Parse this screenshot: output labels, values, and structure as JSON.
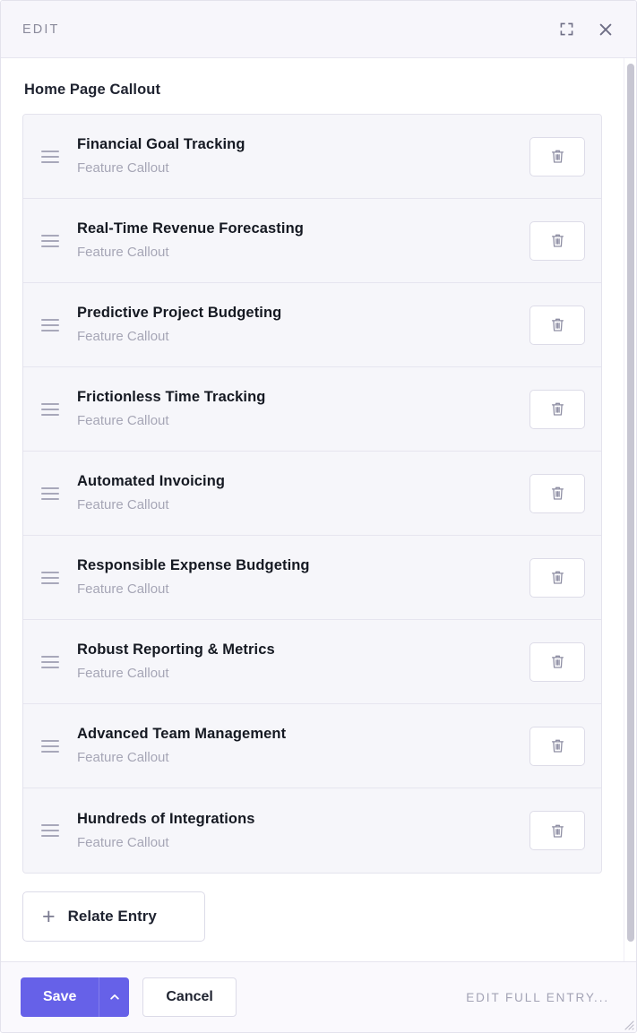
{
  "header": {
    "title": "EDIT",
    "expand_icon": "expand-fullscreen-icon",
    "close_icon": "close-icon"
  },
  "field": {
    "label": "Home Page Callout",
    "items": [
      {
        "title": "Financial Goal Tracking",
        "subtitle": "Feature Callout",
        "drag_icon": "drag-handle-icon",
        "delete_icon": "trash-icon"
      },
      {
        "title": "Real-Time Revenue Forecasting",
        "subtitle": "Feature Callout",
        "drag_icon": "drag-handle-icon",
        "delete_icon": "trash-icon"
      },
      {
        "title": "Predictive Project Budgeting",
        "subtitle": "Feature Callout",
        "drag_icon": "drag-handle-icon",
        "delete_icon": "trash-icon"
      },
      {
        "title": "Frictionless Time Tracking",
        "subtitle": "Feature Callout",
        "drag_icon": "drag-handle-icon",
        "delete_icon": "trash-icon"
      },
      {
        "title": "Automated Invoicing",
        "subtitle": "Feature Callout",
        "drag_icon": "drag-handle-icon",
        "delete_icon": "trash-icon"
      },
      {
        "title": "Responsible Expense Budgeting",
        "subtitle": "Feature Callout",
        "drag_icon": "drag-handle-icon",
        "delete_icon": "trash-icon"
      },
      {
        "title": "Robust Reporting & Metrics",
        "subtitle": "Feature Callout",
        "drag_icon": "drag-handle-icon",
        "delete_icon": "trash-icon"
      },
      {
        "title": "Advanced Team Management",
        "subtitle": "Feature Callout",
        "drag_icon": "drag-handle-icon",
        "delete_icon": "trash-icon"
      },
      {
        "title": "Hundreds of Integrations",
        "subtitle": "Feature Callout",
        "drag_icon": "drag-handle-icon",
        "delete_icon": "trash-icon"
      }
    ],
    "relate_button": {
      "label": "Relate Entry",
      "icon": "plus-icon"
    }
  },
  "footer": {
    "save_label": "Save",
    "save_caret_icon": "chevron-up-icon",
    "cancel_label": "Cancel",
    "edit_full_entry_label": "EDIT FULL ENTRY...",
    "resize_icon": "resize-grip-icon"
  },
  "colors": {
    "accent": "#6661e8",
    "header_bg": "#f7f6fb",
    "item_bg": "#f6f6fa",
    "border": "#e4e3ed",
    "title_text": "#151922",
    "muted_text": "#a6a6b6"
  }
}
